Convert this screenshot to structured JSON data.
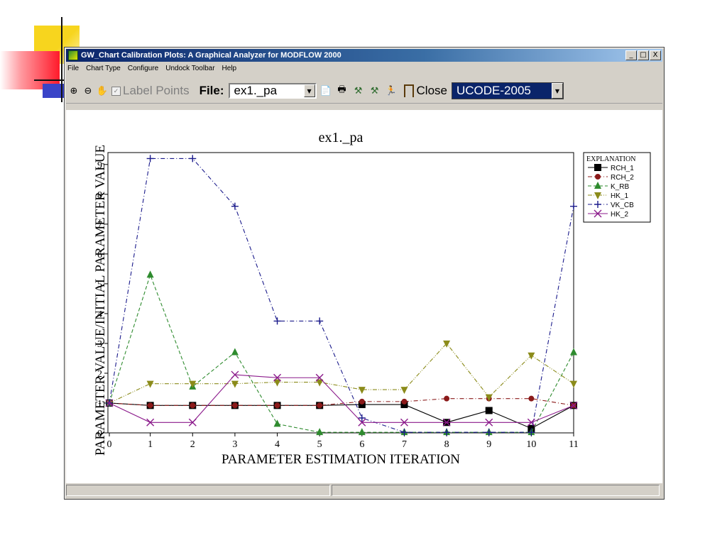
{
  "window": {
    "title": "GW_Chart Calibration Plots: A Graphical Analyzer for MODFLOW 2000",
    "minimize": "_",
    "maximize": "□",
    "close": "X"
  },
  "menu": [
    "File",
    "Chart Type",
    "Configure",
    "Undock Toolbar",
    "Help"
  ],
  "toolbar": {
    "label_points": "Label Points",
    "file_label": "File:",
    "file_value": "ex1._pa",
    "close_label": "Close",
    "program_value": "UCODE-2005"
  },
  "colors": {
    "RCH_1": "#000000",
    "RCH_2": "#8b1a1a",
    "K_RB": "#2e8b2e",
    "HK_1": "#8b8b1a",
    "VK_CB": "#1a1a8b",
    "HK_2": "#8b1a8b"
  },
  "chart_data": {
    "type": "line",
    "title": "ex1._pa",
    "xlabel": "PARAMETER ESTIMATION ITERATION",
    "ylabel": "PARAMETER VALUE/INITIAL PARAMETER VALUE",
    "xlim": [
      0,
      11
    ],
    "ylim": [
      0,
      9.4
    ],
    "x": [
      0,
      1,
      2,
      3,
      4,
      5,
      6,
      7,
      8,
      9,
      10,
      11
    ],
    "xticks": [
      0,
      1,
      2,
      3,
      4,
      5,
      6,
      7,
      8,
      9,
      10,
      11
    ],
    "yticks": [
      0,
      1,
      2,
      3,
      4,
      5,
      6,
      7,
      8,
      9
    ],
    "grid": false,
    "legend_title": "EXPLANATION",
    "legend_position": "right",
    "series": [
      {
        "name": "RCH_1",
        "marker": "square",
        "dash": "solid",
        "values": [
          1.0,
          0.92,
          0.92,
          0.92,
          0.92,
          0.92,
          0.95,
          0.95,
          0.35,
          0.75,
          0.15,
          0.92
        ]
      },
      {
        "name": "RCH_2",
        "marker": "circle",
        "dash": "dashdot",
        "values": [
          1.0,
          0.92,
          0.92,
          0.92,
          0.92,
          0.92,
          1.05,
          1.05,
          1.15,
          1.15,
          1.15,
          0.92
        ]
      },
      {
        "name": "K_RB",
        "marker": "triangle-up",
        "dash": "dashed",
        "values": [
          1.0,
          5.3,
          1.55,
          2.7,
          0.3,
          0.02,
          0.02,
          0.02,
          0.02,
          0.02,
          0.02,
          2.7
        ]
      },
      {
        "name": "HK_1",
        "marker": "triangle-down",
        "dash": "dashdotdot",
        "values": [
          1.0,
          1.65,
          1.65,
          1.65,
          1.7,
          1.7,
          1.45,
          1.45,
          3.0,
          1.2,
          2.6,
          1.65
        ]
      },
      {
        "name": "VK_CB",
        "marker": "plus",
        "dash": "dashdot",
        "values": [
          1.0,
          9.2,
          9.2,
          7.6,
          3.75,
          3.75,
          0.5,
          0.02,
          0.02,
          0.02,
          0.02,
          7.6
        ]
      },
      {
        "name": "HK_2",
        "marker": "x",
        "dash": "solid",
        "values": [
          1.0,
          0.35,
          0.35,
          1.95,
          1.85,
          1.85,
          0.35,
          0.35,
          0.35,
          0.35,
          0.35,
          0.92
        ]
      }
    ]
  }
}
